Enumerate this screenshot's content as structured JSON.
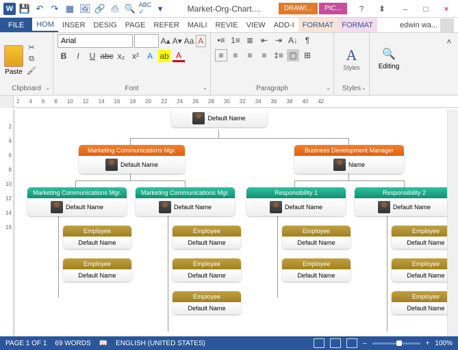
{
  "title": "Market-Org-Chart....",
  "context_tabs": {
    "drawing": "DRAWI...",
    "picture": "PIC..."
  },
  "win": {
    "min": "–",
    "max": "□",
    "close": "×",
    "help": "?"
  },
  "tabs": {
    "file": "FILE",
    "home": "HOM",
    "insert": "INSER",
    "design": "DESIG",
    "page": "PAGE",
    "refer": "REFER",
    "mail": "MAILI",
    "review": "REVIE",
    "view": "VIEW",
    "addin": "ADD-I",
    "fmt1": "FORMAT",
    "fmt2": "FORMAT"
  },
  "user": "edwin wa...",
  "ribbon": {
    "clipboard": {
      "label": "Clipboard",
      "paste": "Paste"
    },
    "font": {
      "label": "Font",
      "name": "Arial",
      "size": ""
    },
    "paragraph": {
      "label": "Paragraph"
    },
    "styles": {
      "label": "Styles",
      "button": "Styles"
    },
    "editing": {
      "label": "Editing",
      "button": "Editing"
    }
  },
  "ruler_marks": [
    "2",
    "4",
    "6",
    "8",
    "10",
    "12",
    "14",
    "16",
    "18",
    "20",
    "22",
    "24",
    "26",
    "28",
    "30",
    "32",
    "34",
    "36",
    "38",
    "40",
    "42"
  ],
  "vruler": [
    "",
    "2",
    "4",
    "6",
    "8",
    "10",
    "12",
    "14",
    "16"
  ],
  "org": {
    "top": {
      "title": "",
      "name": "Default Name"
    },
    "l2a": {
      "title": "Marketing Communications Mgr.",
      "name": "Default Name"
    },
    "l2b": {
      "title": "Business Development Manager",
      "name": "Name"
    },
    "l3a": {
      "title": "Marketing Communications Mgr.",
      "name": "Default Name"
    },
    "l3b": {
      "title": "Marketing Communications Mgr.",
      "name": "Default Name"
    },
    "l3c": {
      "title": "Responsibility 1",
      "name": "Default Name"
    },
    "l3d": {
      "title": "Responsibility 2",
      "name": "Default Name"
    },
    "emp": {
      "title": "Employee",
      "name": "Default Name"
    }
  },
  "status": {
    "page": "PAGE 1 OF 1",
    "words": "69 WORDS",
    "lang": "ENGLISH (UNITED STATES)",
    "zoom": "100%"
  }
}
